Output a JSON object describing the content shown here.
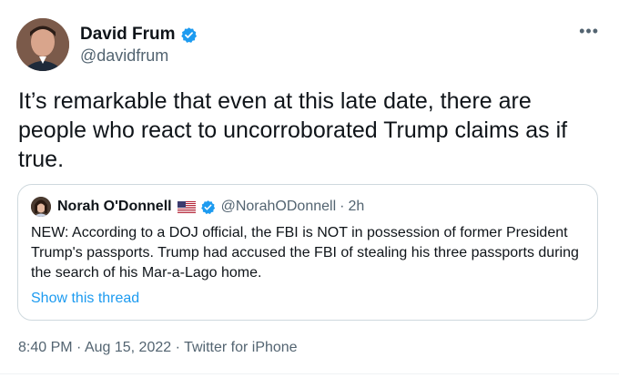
{
  "author": {
    "display_name": "David Frum",
    "handle": "@davidfrum",
    "verified": true
  },
  "menu_icon": "more-horizontal-icon",
  "tweet_text": "It’s remarkable that even at this late date, there are people who react to uncorroborated Trump claims as if true.",
  "quoted_tweet": {
    "display_name": "Norah O'Donnell",
    "flag": "us-flag-icon",
    "verified": true,
    "handle": "@NorahODonnell",
    "separator": "·",
    "time": "2h",
    "text": "NEW: According to a DOJ official, the FBI is NOT in possession of former President Trump's passports. Trump had accused the FBI of stealing his three passports during the search of his Mar-a-Lago home.",
    "show_thread_label": "Show this thread"
  },
  "meta": {
    "time": "8:40 PM",
    "sep1": " · ",
    "date": "Aug 15, 2022",
    "sep2": " · ",
    "source": "Twitter for iPhone"
  },
  "colors": {
    "text": "#0f1419",
    "secondary": "#536471",
    "link": "#1d9bf0",
    "verified": "#1d9bf0",
    "border": "#cfd9de"
  }
}
